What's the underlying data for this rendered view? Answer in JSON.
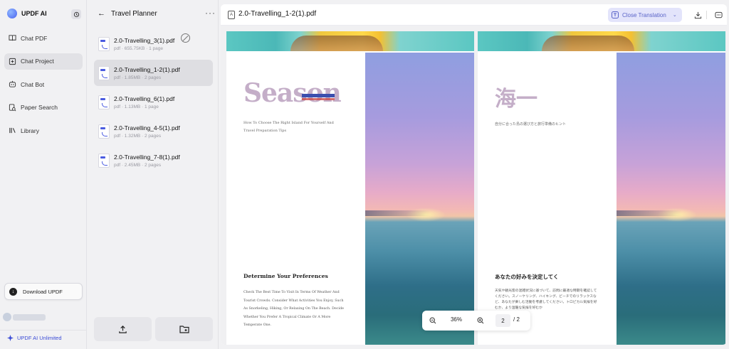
{
  "app": {
    "brand": "UPDF AI"
  },
  "sidebar": {
    "items": [
      {
        "label": "Chat PDF",
        "icon": "book-icon"
      },
      {
        "label": "Chat Project",
        "icon": "project-icon",
        "active": true
      },
      {
        "label": "Chat Bot",
        "icon": "bot-icon"
      },
      {
        "label": "Paper Search",
        "icon": "paper-search-icon"
      },
      {
        "label": "Library",
        "icon": "library-icon"
      }
    ],
    "download_label": "Download UPDF",
    "plan_label": "UPDF AI Unlimited"
  },
  "project": {
    "title": "Travel Planner",
    "files": [
      {
        "name": "2.0-Travelling_3(1).pdf",
        "meta": "pdf · 655.75KB · 1 page"
      },
      {
        "name": "2.0-Travelling_1-2(1).pdf",
        "meta": "pdf · 1.85MB · 2 pages",
        "selected": true
      },
      {
        "name": "2.0-Travelling_6(1).pdf",
        "meta": "pdf · 1.13MB · 1 page"
      },
      {
        "name": "2.0-Travelling_4-5(1).pdf",
        "meta": "pdf · 1.32MB · 2 pages"
      },
      {
        "name": "2.0-Travelling_7-8(1).pdf",
        "meta": "pdf · 2.45MB · 2 pages"
      }
    ]
  },
  "viewer": {
    "doc_title": "2.0-Travelling_1-2(1).pdf",
    "close_translation": "Close Translation",
    "zoom": "36%",
    "current_page": "2",
    "total_pages": "/ 2"
  },
  "page_en": {
    "title": "Season",
    "subtitle": "How To Choose The Right Island For Yourself And Travel Preparation Tips",
    "section": "Determine Your Preferences",
    "body": "Check The Best Time To Visit In Terms Of Weather And Tourist Crowds. Consider What Activities You Enjoy, Such As Snorkeling, Hiking, Or Relaxing On The Beach. Decide Whether You Prefer A Tropical Climate Or A More Temperate One."
  },
  "page_jp": {
    "title": "海一",
    "subtitle": "自分に合った島の選び方と旅行準備のヒント",
    "section": "あなたの好みを決定してく",
    "body": "天気や観光客の混雑状況に基づいて、訪問に最適な時期を確認してください。スノーケリング、ハイキング、ビーチでのリラックスなど、あなたが楽しむ活動を考慮してください。トロピカル気候を好むか、より温暖な気候を好むか"
  },
  "colors": {
    "accent": "#3a4bd6",
    "translate_bg": "#e3e4fb",
    "title_pink": "#c4aec8"
  }
}
